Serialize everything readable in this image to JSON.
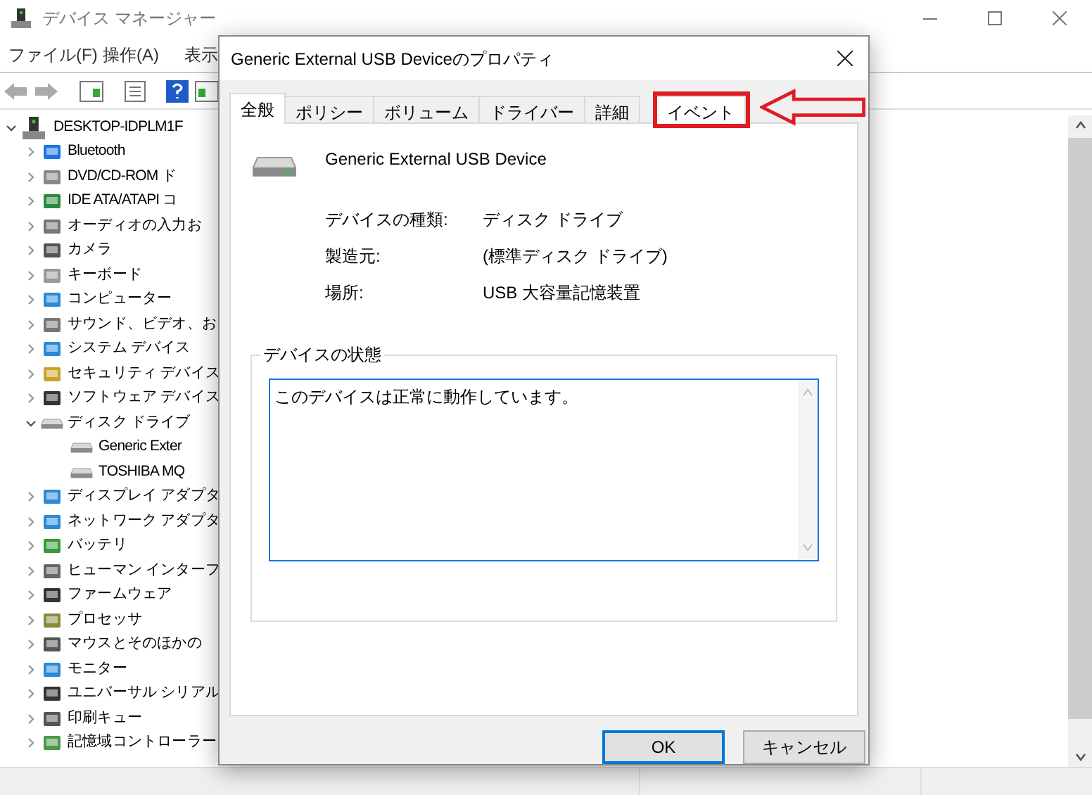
{
  "window": {
    "title": "デバイス マネージャー"
  },
  "menu": [
    "ファイル(F)",
    "操作(A)",
    "表示"
  ],
  "tree": {
    "label": "DESKTOP-IDPLM1F",
    "expanded": true,
    "children": [
      {
        "label": "Bluetooth",
        "expanded": false
      },
      {
        "label": "DVD/CD-ROM ド",
        "expanded": false
      },
      {
        "label": "IDE ATA/ATAPI コ",
        "expanded": false
      },
      {
        "label": "オーディオの入力お",
        "expanded": false
      },
      {
        "label": "カメラ",
        "expanded": false
      },
      {
        "label": "キーボード",
        "expanded": false
      },
      {
        "label": "コンピューター",
        "expanded": false
      },
      {
        "label": "サウンド、ビデオ、お",
        "expanded": false
      },
      {
        "label": "システム デバイス",
        "expanded": false
      },
      {
        "label": "セキュリティ デバイス",
        "expanded": false
      },
      {
        "label": "ソフトウェア デバイス",
        "expanded": false
      },
      {
        "label": "ディスク ドライブ",
        "expanded": true,
        "children": [
          {
            "label": "Generic Exter"
          },
          {
            "label": "TOSHIBA MQ"
          }
        ]
      },
      {
        "label": "ディスプレイ アダプタ",
        "expanded": false
      },
      {
        "label": "ネットワーク アダプタ",
        "expanded": false
      },
      {
        "label": "バッテリ",
        "expanded": false
      },
      {
        "label": "ヒューマン インターフ",
        "expanded": false
      },
      {
        "label": "ファームウェア",
        "expanded": false
      },
      {
        "label": "プロセッサ",
        "expanded": false
      },
      {
        "label": "マウスとそのほかの",
        "expanded": false
      },
      {
        "label": "モニター",
        "expanded": false
      },
      {
        "label": "ユニバーサル シリアル",
        "expanded": false
      },
      {
        "label": "印刷キュー",
        "expanded": false
      },
      {
        "label": "記憶域コントローラー",
        "expanded": false
      }
    ]
  },
  "dialog": {
    "title": "Generic External USB Deviceのプロパティ",
    "tabs": [
      {
        "label": "全般",
        "selected": true,
        "highlighted": false
      },
      {
        "label": "ポリシー",
        "selected": false,
        "highlighted": false
      },
      {
        "label": "ボリューム",
        "selected": false,
        "highlighted": false
      },
      {
        "label": "ドライバー",
        "selected": false,
        "highlighted": false
      },
      {
        "label": "詳細",
        "selected": false,
        "highlighted": false
      },
      {
        "label": "イベント",
        "selected": false,
        "highlighted": true
      }
    ],
    "device_name": "Generic External USB Device",
    "properties": [
      {
        "label": "デバイスの種類:",
        "value": "ディスク ドライブ"
      },
      {
        "label": "製造元:",
        "value": "(標準ディスク ドライブ)"
      },
      {
        "label": "場所:",
        "value": "USB 大容量記憶装置"
      }
    ],
    "status": {
      "title": "デバイスの状態",
      "text": "このデバイスは正常に動作しています。"
    },
    "buttons": [
      {
        "label": "OK",
        "default": true
      },
      {
        "label": "キャンセル",
        "default": false
      }
    ]
  }
}
